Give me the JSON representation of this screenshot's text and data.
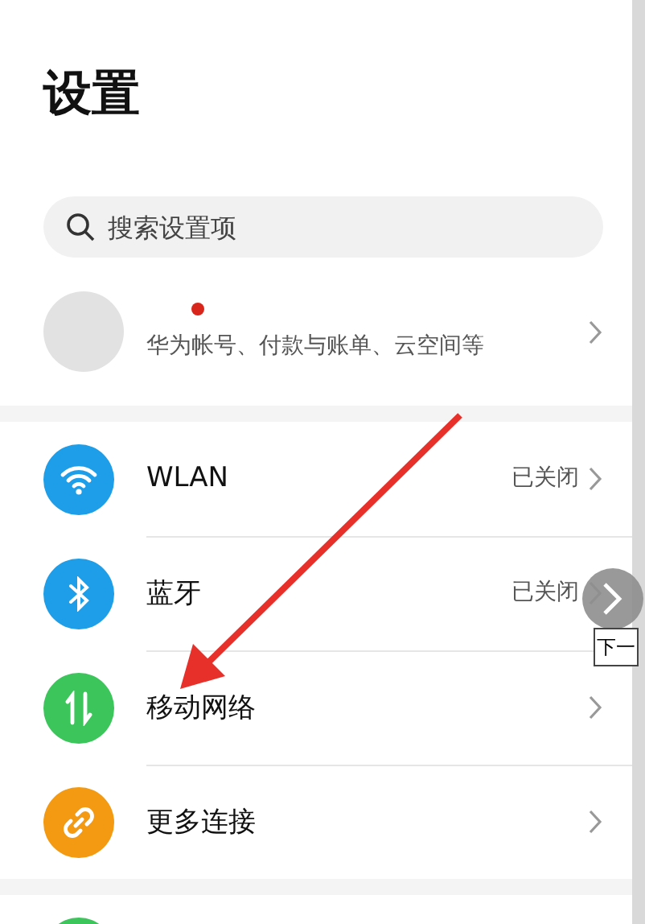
{
  "title": "设置",
  "search": {
    "placeholder": "搜索设置项"
  },
  "account": {
    "subtitle": "华为帐号、付款与账单、云空间等",
    "badge": true
  },
  "groups": [
    {
      "rows": [
        {
          "kind": "wifi",
          "color": "#1e9ee8",
          "label": "WLAN",
          "status": "已关闭"
        },
        {
          "kind": "bluetooth",
          "color": "#1e9ee8",
          "label": "蓝牙",
          "status": "已关闭"
        },
        {
          "kind": "updown",
          "color": "#3cc55a",
          "label": "移动网络"
        },
        {
          "kind": "link",
          "color": "#f39a12",
          "label": "更多连接"
        }
      ]
    },
    {
      "rows": [
        {
          "color": "#3cc55a"
        }
      ]
    }
  ],
  "annotation": {
    "kind": "arrow"
  },
  "next_button": {
    "tooltip": "下一"
  }
}
